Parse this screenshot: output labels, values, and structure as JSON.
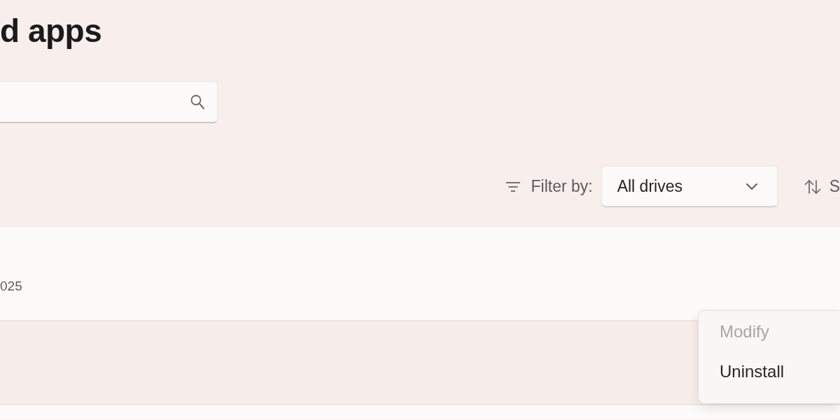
{
  "page": {
    "title": "d apps"
  },
  "filter": {
    "label": "Filter by:",
    "value": "All drives"
  },
  "sort": {
    "label": "S"
  },
  "app_list": {
    "rows": [
      {
        "detail": "025",
        "highlighted": false
      },
      {
        "highlighted": true
      },
      {
        "highlighted": false
      }
    ]
  },
  "context_menu": {
    "items": [
      {
        "label": "Modify",
        "disabled": true
      },
      {
        "label": "Uninstall",
        "disabled": false
      }
    ]
  }
}
